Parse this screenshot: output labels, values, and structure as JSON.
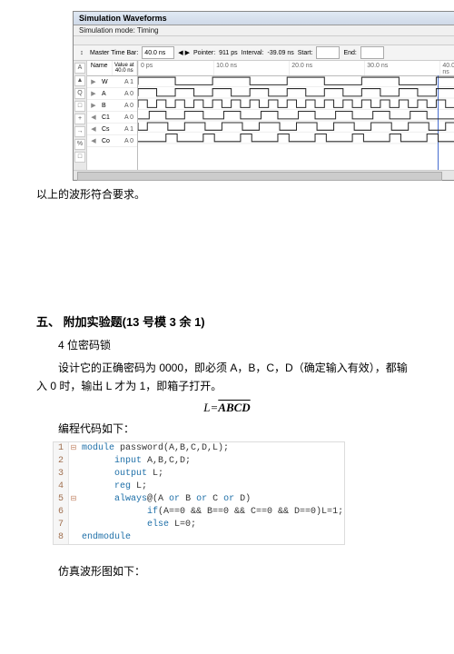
{
  "waveform": {
    "title": "Simulation Waveforms",
    "mode": "Simulation mode: Timing",
    "toolbar": {
      "master_label": "Master Time Bar:",
      "master_value": "40.0 ns",
      "pointer_label": "Pointer:",
      "pointer_value": "911 ps",
      "interval_label": "Interval:",
      "interval_value": "-39.09 ns",
      "start_label": "Start:",
      "end_label": "End:"
    },
    "name_header": "Name",
    "value_header": "Value at 40.0 ns",
    "time_ticks": [
      "0 ps",
      "10.0 ns",
      "20.0 ns",
      "30.0 ns",
      "40.0 ns"
    ],
    "left_tools": [
      "A",
      "▲",
      "Q",
      "□",
      "+",
      "→",
      "%",
      "□"
    ],
    "signals": [
      {
        "icon": "▶",
        "name": "W",
        "value": "A 1"
      },
      {
        "icon": "▶",
        "name": "A",
        "value": "A 0"
      },
      {
        "icon": "▶",
        "name": "B",
        "value": "A 0"
      },
      {
        "icon": "◀",
        "name": "C1",
        "value": "A 0"
      },
      {
        "icon": "◀",
        "name": "Cs",
        "value": "A 1"
      },
      {
        "icon": "◀",
        "name": "Co",
        "value": "A 0"
      }
    ]
  },
  "text": {
    "caption": "以上的波形符合要求。",
    "section": "五、  附加实验题(13 号模 3 余 1)",
    "sub1": "4 位密码锁",
    "sub2": "设计它的正确密码为 0000，即必须 A，B，C，D（确定输入有效），都输入 0 时，输出 L 才为 1，即箱子打开。",
    "formula_lhs": "L=",
    "formula_rhs": "ABCD",
    "code_intro": "编程代码如下：",
    "after_code": "仿真波形图如下："
  },
  "code": [
    {
      "n": "1",
      "sq": "⊟",
      "t": "module password(A,B,C,D,L);"
    },
    {
      "n": "2",
      "sq": "",
      "t": "      input A,B,C,D;"
    },
    {
      "n": "3",
      "sq": "",
      "t": "      output L;"
    },
    {
      "n": "4",
      "sq": "",
      "t": "      reg L;"
    },
    {
      "n": "5",
      "sq": "⊟",
      "t": "      always@(A or B or C or D)"
    },
    {
      "n": "6",
      "sq": "",
      "t": "            if(A==0 && B==0 && C==0 && D==0)L=1;"
    },
    {
      "n": "7",
      "sq": "",
      "t": "            else L=0;"
    },
    {
      "n": "8",
      "sq": "",
      "t": "endmodule"
    }
  ],
  "chart_data": {
    "type": "timing-diagram",
    "time_unit": "ns",
    "time_range": [
      0,
      40
    ],
    "cursor": 40.0,
    "signals": [
      {
        "name": "W",
        "pattern": "clock",
        "period_ns": 5.0,
        "value_at_cursor": 1
      },
      {
        "name": "A",
        "pattern": "clock",
        "period_ns": 2.5,
        "value_at_cursor": 0
      },
      {
        "name": "B",
        "pattern": "clock",
        "period_ns": 1.25,
        "value_at_cursor": 0
      },
      {
        "name": "C1",
        "pattern": "derived",
        "value_at_cursor": 0
      },
      {
        "name": "Cs",
        "pattern": "derived",
        "value_at_cursor": 1
      },
      {
        "name": "Co",
        "pattern": "derived",
        "value_at_cursor": 0
      }
    ]
  }
}
